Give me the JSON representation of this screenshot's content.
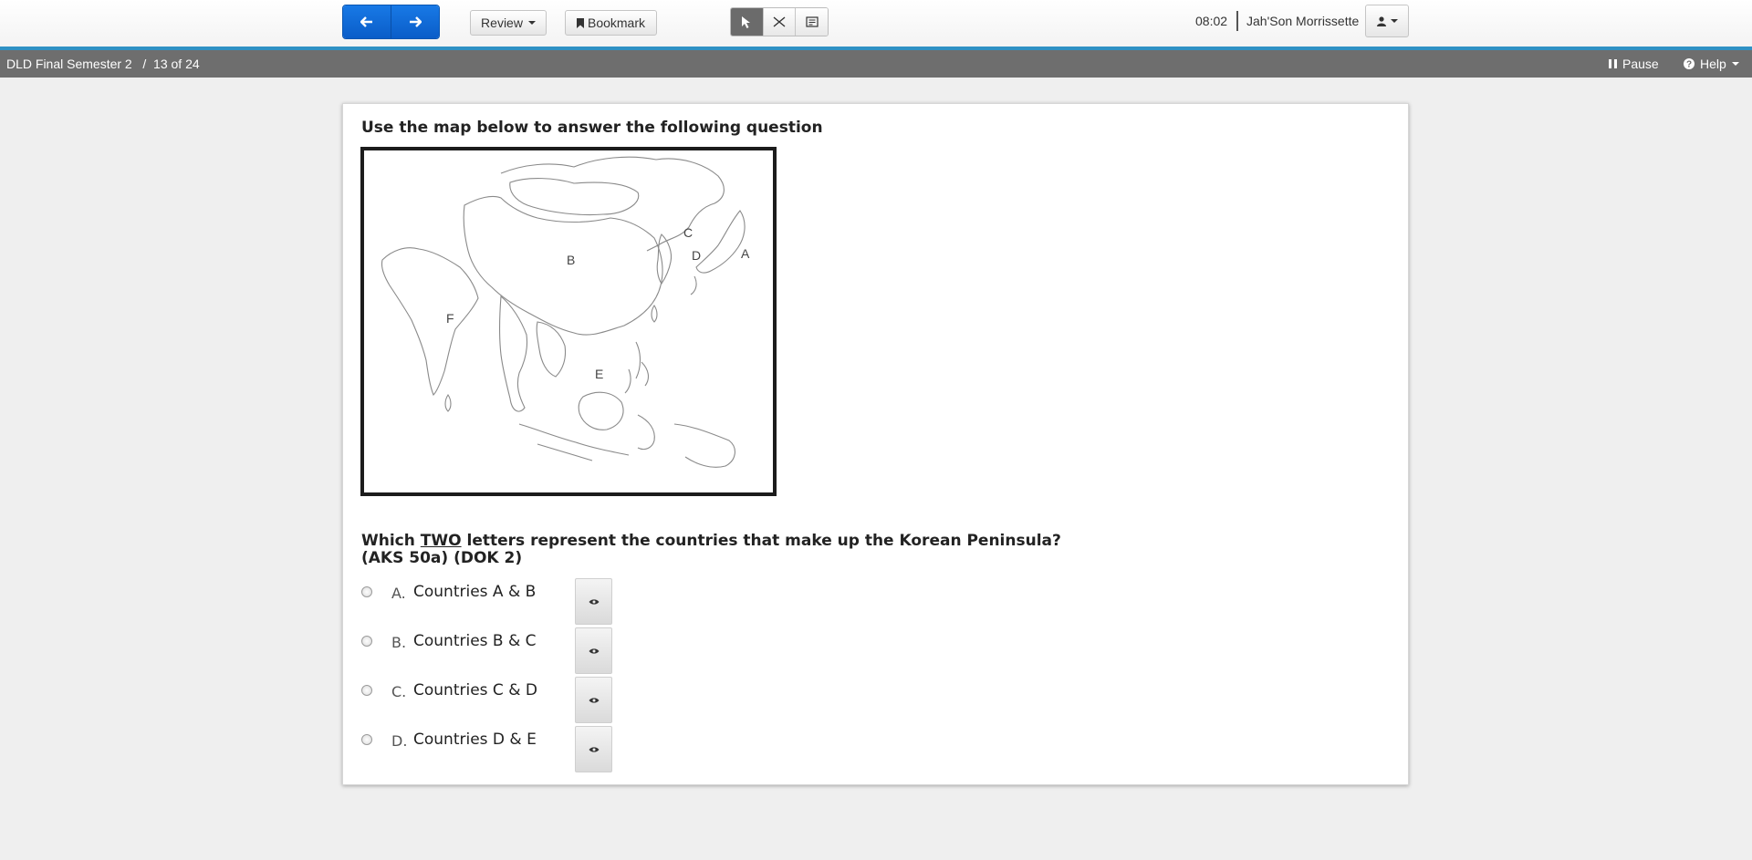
{
  "toolbar": {
    "prev_icon": "arrow-left-icon",
    "next_icon": "arrow-right-icon",
    "review_label": "Review",
    "bookmark_label": "Bookmark",
    "tools": [
      "pointer-icon",
      "eliminate-icon",
      "notes-icon"
    ],
    "timer": "08:02",
    "username": "Jah'Son Morrissette",
    "accent_color": "#0a5dc8"
  },
  "titlebar": {
    "test_title": "DLD Final Semester 2   /  13 of 24",
    "pause_label": "Pause",
    "help_label": "Help"
  },
  "question": {
    "instruction": "Use the map below to answer the following question",
    "map_labels": [
      "C",
      "D",
      "A",
      "B",
      "F",
      "E"
    ],
    "stem_before": "Which ",
    "stem_emph": "TWO",
    "stem_after": " letters represent the countries that make up the Korean Peninsula?",
    "stem_line2": "(AKS 50a) (DOK 2)",
    "options": [
      {
        "letter": "A.",
        "text": "Countries A & B"
      },
      {
        "letter": "B.",
        "text": "Countries B & C"
      },
      {
        "letter": "C.",
        "text": "Countries C & D"
      },
      {
        "letter": "D.",
        "text": "Countries D & E"
      }
    ]
  }
}
